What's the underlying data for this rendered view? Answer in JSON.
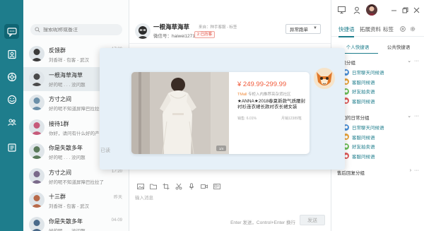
{
  "search": {
    "placeholder": "搜索昵称或备注"
  },
  "conversations": [
    {
      "name": "反馈群",
      "sub": "刘香祥 - 包客 - 武汉",
      "time": "17:20",
      "avatar_color": "#3a3a3a"
    },
    {
      "name": "一根海草海草",
      "sub": "好的呢 . . . 没问题",
      "time": "",
      "avatar_color": "#4a4a4a"
    },
    {
      "name": "方寸之间",
      "sub": "好的呢不知道屏障巴拉拉了",
      "time": "",
      "avatar_color": "#6b8fa8"
    },
    {
      "name": "接待1群",
      "sub": "你好，请问有什么好的产品",
      "time": "",
      "avatar_color": "#c65a7a"
    },
    {
      "name": "你是失散多年",
      "sub": "好的呢 . . . 没问题",
      "time": "",
      "avatar_color": "#5a7a5a"
    },
    {
      "name": "方寸之间",
      "sub": "好的呢不知道屏障巴拉拉了",
      "time": "17:20",
      "avatar_color": "#7a6a8a"
    },
    {
      "name": "十三群",
      "sub": "刘香祥 - 包客 - 武汉",
      "time": "昨天",
      "avatar_color": "#b86a4a"
    },
    {
      "name": "你是失散多年",
      "sub": "好的呢 . . . 没问题",
      "time": "04-09",
      "avatar_color": "#4a6a8a"
    }
  ],
  "chat": {
    "name": "一根海草海草",
    "from": "来自：种手客服 - 标签",
    "wechat": "微信号：haiwei1271",
    "badge": "2 已历客",
    "status_select": "异常跑单",
    "input_placeholder": "输入消息",
    "send_hint": "Enter 发送，Control+Enter 换行",
    "send_label": "发送"
  },
  "popup": {
    "read_label": "已读",
    "price": "¥ 249.99-299.99",
    "shop_prefix": "TMall",
    "shop": "专柜入内推荐亮杂货社区",
    "title": "★ANNA★2018春夏新款气质腰封衬衫连衣裙长款衬衣长裙女装",
    "sales": "销售: 6.01%",
    "stock": "月销12389笔",
    "img_badge": "1/4"
  },
  "right_panel": {
    "tabs": [
      "快捷语",
      "拓展资料",
      "标签"
    ],
    "subtabs": [
      "个人快捷语",
      "公共快捷语"
    ],
    "groups": [
      {
        "name": "问候分组",
        "items": [
          {
            "label": "日常聊天问候语",
            "color": "#4a90d9"
          },
          {
            "label": "客服问候语",
            "color": "#e9a43a"
          },
          {
            "label": "好友拍卖语",
            "color": "#6cbf5a"
          },
          {
            "label": "客服问候语",
            "color": "#e05a5a"
          }
        ]
      },
      {
        "name": "我们的日常分组",
        "items": [
          {
            "label": "日常聊天问候语",
            "color": "#4a90d9"
          },
          {
            "label": "客服问候语",
            "color": "#e9a43a"
          },
          {
            "label": "好友拍卖语",
            "color": "#6cbf5a"
          },
          {
            "label": "客服问候语",
            "color": "#e05a5a"
          }
        ]
      },
      {
        "name": "售后回复分组",
        "items": []
      }
    ]
  },
  "colors": {
    "accent": "#1e7d8c",
    "price": "#f05a3a"
  }
}
